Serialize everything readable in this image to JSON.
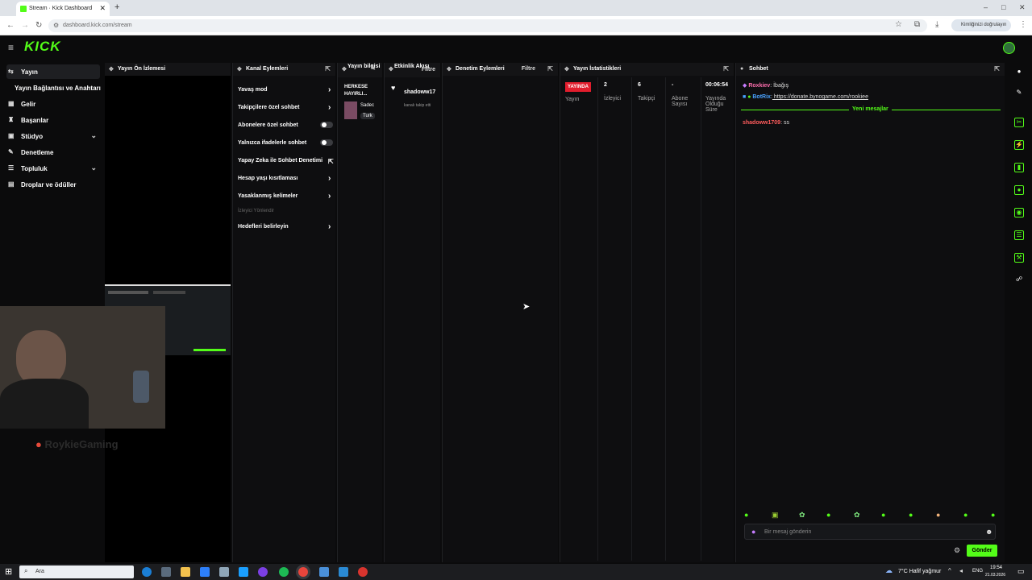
{
  "browser": {
    "tab_title": "Stream · Kick Dashboard",
    "new_tab": "+",
    "url": "dashboard.kick.com/stream",
    "profile": "Kimliğinizi doğrulayın",
    "window_controls": [
      "–",
      "□",
      "✕"
    ]
  },
  "app": {
    "logo": "KICK",
    "sidenav": {
      "items": [
        {
          "label": "Yayın",
          "icon": "broadcast-icon",
          "active": true
        },
        {
          "label": "Yayın Bağlantısı ve Anahtarı",
          "icon": "",
          "active": false
        },
        {
          "label": "Gelir",
          "icon": "money-icon",
          "active": false
        },
        {
          "label": "Başarılar",
          "icon": "trophy-icon",
          "active": false
        },
        {
          "label": "Stüdyo",
          "icon": "camera-icon",
          "active": false,
          "chevron": "⌄"
        },
        {
          "label": "Denetleme",
          "icon": "shield-icon",
          "active": false
        },
        {
          "label": "Topluluk",
          "icon": "people-icon",
          "active": false,
          "chevron": "⌄"
        },
        {
          "label": "Droplar ve ödüller",
          "icon": "gift-icon",
          "active": false
        }
      ]
    },
    "preview": {
      "title": "Yayın Ön İzlemesi",
      "watermark": "RoykieGaming"
    },
    "channel_actions": {
      "title": "Kanal Eylemleri",
      "items": [
        {
          "label": "Yavaş mod",
          "type": "arrow"
        },
        {
          "label": "Takipçilere özel sohbet",
          "type": "arrow"
        },
        {
          "label": "Abonelere özel sohbet",
          "type": "toggle"
        },
        {
          "label": "Yalnızca ifadelerle sohbet",
          "type": "toggle"
        },
        {
          "label": "Yapay Zeka ile Sohbet Denetimi",
          "type": "external"
        },
        {
          "label": "Hesap yaşı kısıtlaması",
          "type": "arrow"
        },
        {
          "label": "Yasaklanmış kelimeler",
          "type": "arrow"
        }
      ],
      "section_label": "İzleyici Yönlendir",
      "goals": "Hedefleri belirleyin"
    },
    "stream_info": {
      "title": "Yayın bilgisi",
      "stream_title": "HERKESE HAYIRLI...",
      "category": "Sadec",
      "tag": "Turk"
    },
    "activity": {
      "title": "Etkinlik Akışı",
      "filter": "Filtre",
      "user": "shadoww17",
      "desc": "kanalı takip etti"
    },
    "moderation": {
      "title": "Denetim Eylemleri",
      "filter": "Filtre"
    },
    "stats": {
      "title": "Yayın İstatistikleri",
      "live": "YAYINDA",
      "cols": [
        {
          "value": "",
          "label": "Yayın"
        },
        {
          "value": "2",
          "label": "İzleyici"
        },
        {
          "value": "6",
          "label": "Takipçi"
        },
        {
          "value": "-",
          "label": "Abone Sayısı"
        },
        {
          "value": "00:06:54",
          "label": "Yayında Olduğu Süre"
        }
      ]
    },
    "chat": {
      "title": "Sohbet",
      "messages": [
        {
          "user": "Roxkiev",
          "sep": ":",
          "text": " İbağış",
          "color": "#ff6fae"
        },
        {
          "user": "BotRix",
          "sep": ":",
          "text": " https://donate.bynogame.com/rookiee",
          "color": "#4aa3ff"
        }
      ],
      "new_messages": "Yeni mesajlar",
      "last": {
        "user": "shadoww1709",
        "text": ": ss"
      },
      "placeholder": "Bir mesaj gönderin",
      "send": "Gönder"
    }
  },
  "taskbar": {
    "search": "Ara",
    "weather": "7°C  Hafif yağmur",
    "lang": "ENG",
    "time": "19:54",
    "date": "21.03.2026"
  },
  "colors": {
    "accent": "#53fc18",
    "live": "#e21d2d"
  }
}
